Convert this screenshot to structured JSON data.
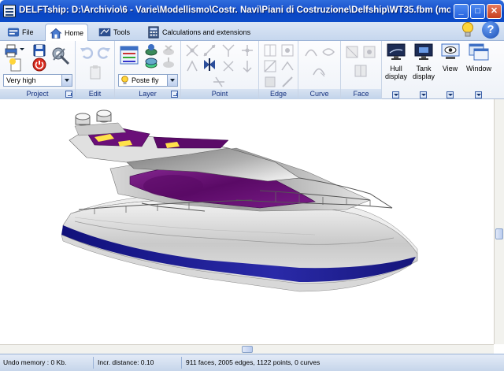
{
  "window": {
    "title": "DELFTship: D:\\Archivio\\6 - Varie\\Modellismo\\Costr. Navi\\Piani di Costruzione\\Delfship\\WT35.fbm (mod...",
    "minimize": "_",
    "maximize": "□",
    "close": "✕"
  },
  "tabs": [
    {
      "label": "File",
      "icon": "file-icon"
    },
    {
      "label": "Home",
      "icon": "home-icon",
      "active": true
    },
    {
      "label": "Tools",
      "icon": "tools-icon"
    },
    {
      "label": "Calculations and extensions",
      "icon": "calculator-icon"
    }
  ],
  "help_label": "?",
  "ribbon": {
    "groups": {
      "project": "Project",
      "edit": "Edit",
      "layer": "Layer",
      "point": "Point",
      "edge": "Edge",
      "curve": "Curve",
      "face": "Face"
    },
    "precision_select": "Very high",
    "layer_select": "Poste fly",
    "buttons": {
      "hull_display": "Hull display",
      "tank_display": "Tank display",
      "view": "View",
      "window": "Window"
    }
  },
  "colors": {
    "hull_blue": "#1a1a8a",
    "superstructure_purple": "#6a0f78",
    "titlebar": "#0a46c4"
  },
  "status": {
    "undo_memory": "Undo memory : 0 Kb.",
    "incr_distance": "Incr. distance: 0.10",
    "counts": "911 faces, 2005 edges, 1122 points, 0 curves"
  }
}
